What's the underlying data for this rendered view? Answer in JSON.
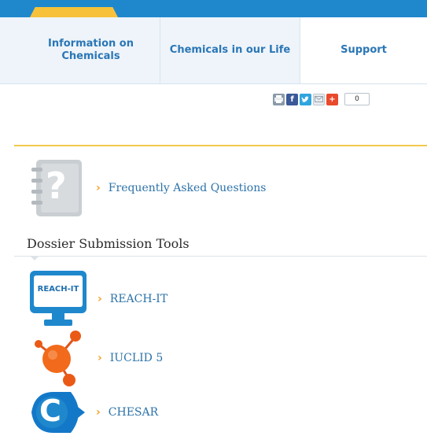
{
  "nav": {
    "tabs": [
      {
        "label_line1": "Information on",
        "label_line2": "Chemicals"
      },
      {
        "label": "Chemicals in our Life"
      },
      {
        "label": "Support"
      }
    ]
  },
  "share": {
    "count": "0"
  },
  "faq": {
    "label": "Frequently Asked Questions",
    "icon_text": "?"
  },
  "section": {
    "title": "Dossier Submission Tools"
  },
  "tools": [
    {
      "label": "REACH-IT",
      "icon_text": "REACH-IT"
    },
    {
      "label": "IUCLID 5"
    },
    {
      "label": "CHESAR",
      "icon_text": "C"
    }
  ],
  "colors": {
    "brand_blue": "#1f88cd",
    "accent_yellow": "#f7c23a",
    "link_blue": "#2d73a9",
    "chevron_orange": "#f2a329"
  }
}
